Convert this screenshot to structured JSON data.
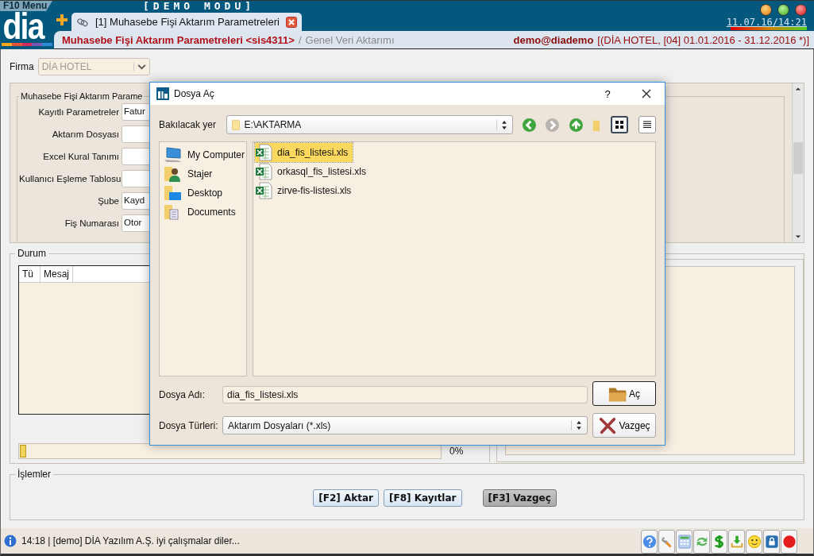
{
  "app": {
    "menu_label": "F10 Menu",
    "mode": "[DEMO MODU]",
    "logo": "dia",
    "datetime": "11.07.16/14:21"
  },
  "tabs": [
    {
      "label": "[1] Muhasebe Fişi Aktarım Parametreleri",
      "selected": true
    }
  ],
  "breadcrumb": {
    "title": "Muhasebe Fişi Aktarım Parametreleri <sis4311>",
    "separator": "/",
    "section": "Genel Veri Aktarımı",
    "user": "demo@diademo",
    "context": "[(DİA HOTEL, [04] 01.01.2016 - 31.12.2016 *)]"
  },
  "firma": {
    "label": "Firma",
    "value": "DİA HOTEL"
  },
  "parameters": {
    "legend": "Muhasebe Fişi Aktarım Parame",
    "fields": [
      {
        "label": "Kayıtlı Parametreler",
        "value": "Fatur"
      },
      {
        "label": "Aktarım Dosyası"
      },
      {
        "label": "Excel Kural Tanımı"
      },
      {
        "label": "Kullanıcı Eşleme Tablosu"
      },
      {
        "label": "Şube",
        "value": "Kayd"
      },
      {
        "label": "Fiş Numarası",
        "value": "Otor"
      }
    ]
  },
  "status_panel": {
    "legend": "Durum",
    "columns": [
      "Tü",
      "Mesaj"
    ],
    "progress": {
      "level": 0.015,
      "reading": "0%"
    }
  },
  "actions": {
    "legend": "İşlemler",
    "buttons": [
      {
        "label": "[F2] Aktar",
        "pressed": false
      },
      {
        "label": "[F8] Kayıtlar",
        "pressed": false
      },
      {
        "label": "[F3] Vazgeç",
        "pressed": true
      }
    ]
  },
  "dialog": {
    "title": "Dosya Aç",
    "help": "?",
    "look_in_label": "Bakılacak yer",
    "path": "E:\\AKTARMA",
    "view_modes": [
      {
        "kind": "icons",
        "selected": true
      },
      {
        "kind": "details",
        "selected": false
      }
    ],
    "places": [
      {
        "kind": "computer",
        "label": "My Computer"
      },
      {
        "kind": "user",
        "label": "Stajer"
      },
      {
        "kind": "desktop",
        "label": "Desktop"
      },
      {
        "kind": "documents",
        "label": "Documents"
      }
    ],
    "files": [
      {
        "name": "dia_fis_listesi.xls",
        "selected": true
      },
      {
        "name": "orkasql_fis_listesi.xls",
        "selected": false
      },
      {
        "name": "zirve-fis-listesi.xls",
        "selected": false
      }
    ],
    "filename_label": "Dosya Adı:",
    "filename": "dia_fis_listesi.xls",
    "filetype_label": "Dosya Türleri:",
    "filetype": "Aktarım Dosyaları (*.xls)",
    "open_button": "Aç",
    "cancel_button": "Vazgeç"
  },
  "status_bar": {
    "message": "14:18 | [demo] DİA Yazılım A.Ş. iyi çalışmalar diler..."
  }
}
